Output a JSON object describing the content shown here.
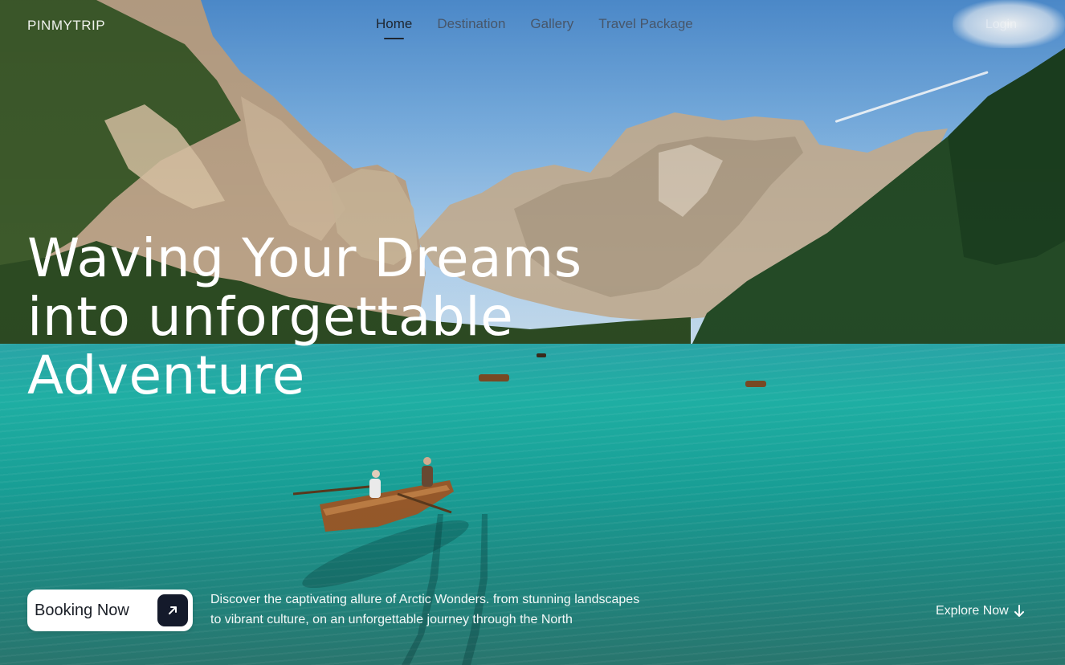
{
  "brand": {
    "name": "PINMYTRIP"
  },
  "nav": {
    "items": [
      {
        "label": "Home",
        "active": true
      },
      {
        "label": "Destination",
        "active": false
      },
      {
        "label": "Gallery",
        "active": false
      },
      {
        "label": "Travel Package",
        "active": false
      }
    ],
    "top_right": "Login"
  },
  "hero": {
    "headline_lines": [
      "Waving Your Dreams",
      "into unforgettable",
      "Adventure"
    ],
    "booking_label": "Booking Now",
    "description_lines": [
      "Discover the captivating allure of Arctic Wonders. from stunning landscapes",
      "to vibrant culture, on an unforgettable journey through the North"
    ],
    "explore_label": "Explore Now"
  },
  "icons": {
    "booking": "arrow-up-right-icon",
    "explore": "arrow-down-icon"
  },
  "colors": {
    "sky": "#78aee0",
    "lake": "#1fb2a6",
    "forest": "#244a26",
    "rock": "#c9b79c",
    "button_bg": "#ffffff",
    "arrow_bg": "#141a2b",
    "text_light": "#ffffff",
    "nav_active": "#1e2630"
  }
}
